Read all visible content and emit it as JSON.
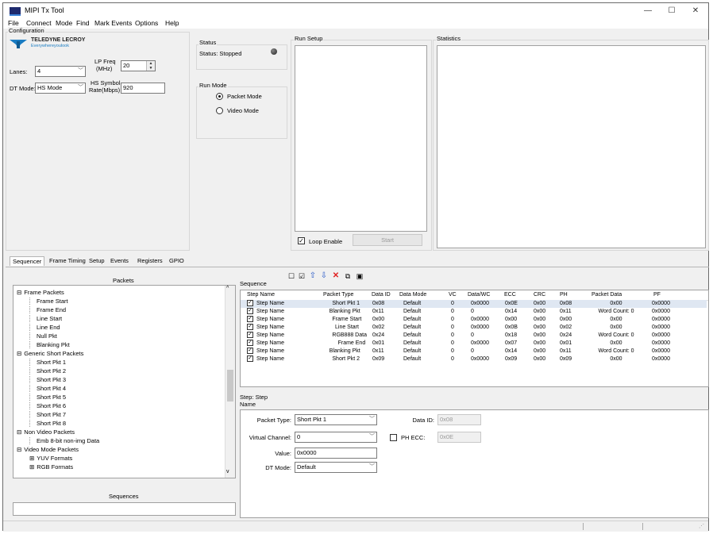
{
  "window": {
    "title": "MIPI Tx Tool",
    "minimize": "—",
    "maximize": "☐",
    "close": "✕"
  },
  "menu": [
    "File",
    "Connect",
    "Mode",
    "Find",
    "Mark Events",
    "Options",
    "Help"
  ],
  "configuration": {
    "title": "Configuration",
    "logo_name": "TELEDYNE LECROY",
    "logo_tagline": "Everywhereyoulook",
    "lanes_label": "Lanes:",
    "lanes_value": "4",
    "lp_freq_label_1": "LP Freq",
    "lp_freq_label_2": "(MHz)",
    "lp_freq_value": "20",
    "dt_mode_label": "DT Mode:",
    "dt_mode_value": "HS Mode",
    "hs_symbol_label_1": "HS Symbol",
    "hs_symbol_label_2": "Rate(Mbps)",
    "hs_symbol_value": "920"
  },
  "status": {
    "title": "Status",
    "text": "Status: Stopped"
  },
  "run_mode": {
    "title": "Run Mode",
    "packet_mode": "Packet Mode",
    "video_mode": "Video Mode"
  },
  "run_setup": {
    "title": "Run Setup",
    "loop_enable": "Loop Enable",
    "start": "Start"
  },
  "statistics": {
    "title": "Statistics"
  },
  "tabs": [
    "Sequencer",
    "Frame Timing",
    "Setup",
    "Events",
    "Registers",
    "GPIO"
  ],
  "packets": {
    "title": "Packets",
    "tree": [
      {
        "label": "Frame Packets",
        "level": 0,
        "expander": "⊟"
      },
      {
        "label": "Frame Start",
        "level": 1
      },
      {
        "label": "Frame End",
        "level": 1
      },
      {
        "label": "Line Start",
        "level": 1
      },
      {
        "label": "Line End",
        "level": 1
      },
      {
        "label": "Null Pkt",
        "level": 1
      },
      {
        "label": "Blanking Pkt",
        "level": 1
      },
      {
        "label": "Generic Short Packets",
        "level": 0,
        "expander": "⊟"
      },
      {
        "label": "Short Pkt 1",
        "level": 1
      },
      {
        "label": "Short Pkt 2",
        "level": 1
      },
      {
        "label": "Short Pkt 3",
        "level": 1
      },
      {
        "label": "Short Pkt 4",
        "level": 1
      },
      {
        "label": "Short Pkt 5",
        "level": 1
      },
      {
        "label": "Short Pkt 6",
        "level": 1
      },
      {
        "label": "Short Pkt 7",
        "level": 1
      },
      {
        "label": "Short Pkt 8",
        "level": 1
      },
      {
        "label": "Non Video Packets",
        "level": 0,
        "expander": "⊟"
      },
      {
        "label": "Emb 8-bit non-img Data",
        "level": 1
      },
      {
        "label": "Video Mode Packets",
        "level": 0,
        "expander": "⊟"
      },
      {
        "label": "YUV Formats",
        "level": 1,
        "expander": "⊞"
      },
      {
        "label": "RGB Formats",
        "level": 1,
        "expander": "⊞"
      }
    ]
  },
  "sequences": {
    "title": "Sequences"
  },
  "sequence": {
    "title": "Sequence",
    "columns": [
      "Step Name",
      "Packet Type",
      "Data ID",
      "Data Mode",
      "VC",
      "Data/WC",
      "ECC",
      "CRC",
      "PH",
      "Packet Data",
      "PF"
    ],
    "rows": [
      [
        "Step Name",
        "Short Pkt 1",
        "0x08",
        "Default",
        "0",
        "0x0000",
        "0x0E",
        "0x00",
        "0x08",
        "0x00",
        "0x0000"
      ],
      [
        "Step Name",
        "Blanking Pkt",
        "0x11",
        "Default",
        "0",
        "0",
        "0x14",
        "0x00",
        "0x11",
        "Word Count: 0",
        "0x0000"
      ],
      [
        "Step Name",
        "Frame Start",
        "0x00",
        "Default",
        "0",
        "0x0000",
        "0x00",
        "0x00",
        "0x00",
        "0x00",
        "0x0000"
      ],
      [
        "Step Name",
        "Line Start",
        "0x02",
        "Default",
        "0",
        "0x0000",
        "0x0B",
        "0x00",
        "0x02",
        "0x00",
        "0x0000"
      ],
      [
        "Step Name",
        "RGB888 Data",
        "0x24",
        "Default",
        "0",
        "0",
        "0x18",
        "0x00",
        "0x24",
        "Word Count: 0",
        "0x0000"
      ],
      [
        "Step Name",
        "Frame End",
        "0x01",
        "Default",
        "0",
        "0x0000",
        "0x07",
        "0x00",
        "0x01",
        "0x00",
        "0x0000"
      ],
      [
        "Step Name",
        "Blanking Pkt",
        "0x11",
        "Default",
        "0",
        "0",
        "0x14",
        "0x00",
        "0x11",
        "Word Count: 0",
        "0x0000"
      ],
      [
        "Step Name",
        "Short Pkt 2",
        "0x09",
        "Default",
        "0",
        "0x0000",
        "0x09",
        "0x00",
        "0x09",
        "0x00",
        "0x0000"
      ]
    ]
  },
  "step": {
    "title_1": "Step: Step",
    "title_2": "Name",
    "packet_type_label": "Packet Type:",
    "packet_type_value": "Short Pkt 1",
    "data_id_label": "Data ID:",
    "data_id_value": "0x08",
    "virtual_channel_label": "Virtual Channel:",
    "virtual_channel_value": "0",
    "ph_ecc_label": "PH ECC:",
    "ph_ecc_value": "0x0E",
    "value_label": "Value:",
    "value_value": "0x0000",
    "dt_mode_label": "DT Mode:",
    "dt_mode_value": "Default"
  },
  "toolbar_icons": [
    "uncheck-all-icon",
    "check-all-icon",
    "move-up-icon",
    "move-down-icon",
    "delete-icon",
    "copy-icon",
    "paste-icon"
  ]
}
